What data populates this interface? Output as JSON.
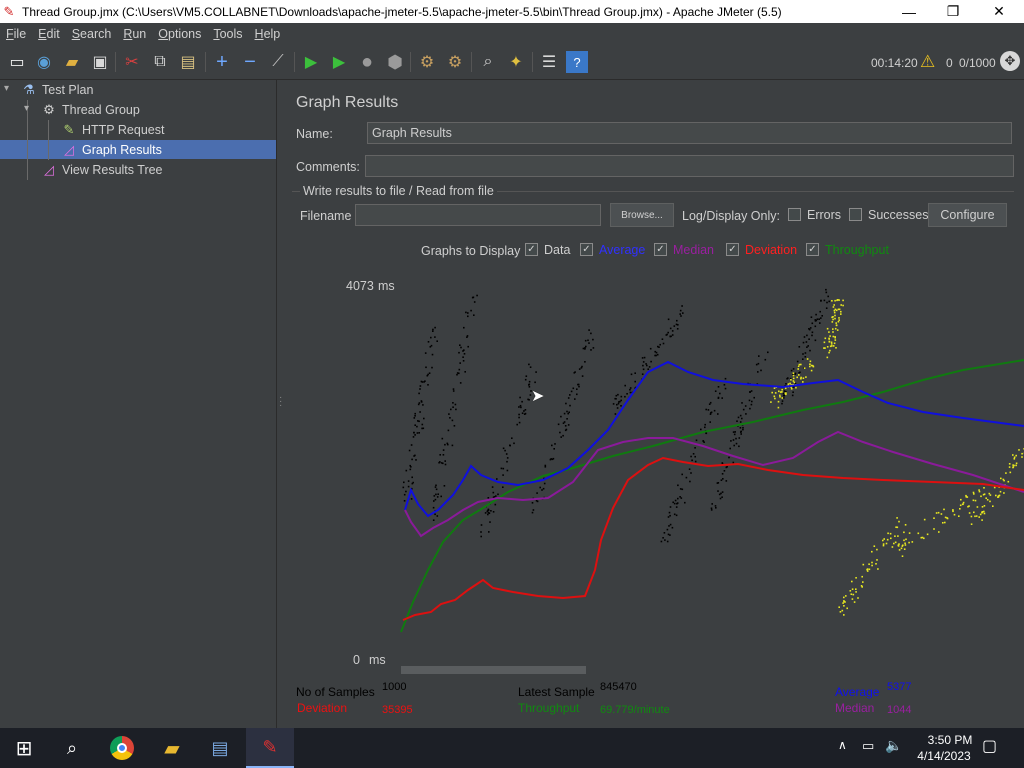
{
  "window": {
    "title": "Thread Group.jmx (C:\\Users\\VM5.COLLABNET\\Downloads\\apache-jmeter-5.5\\apache-jmeter-5.5\\bin\\Thread Group.jmx) - Apache JMeter (5.5)",
    "minimize": "—",
    "maximize": "❐",
    "close": "✕"
  },
  "menu": [
    "File",
    "Edit",
    "Search",
    "Run",
    "Options",
    "Tools",
    "Help"
  ],
  "toolbar": {
    "timer": "00:14:20",
    "warning_count": "0",
    "threads": "0/1000",
    "icons": [
      "new-icon",
      "templates-icon",
      "open-icon",
      "save-icon",
      "cut-icon",
      "copy-icon",
      "paste-icon",
      "expand-icon",
      "collapse-icon",
      "toggle-icon",
      "start-icon",
      "start-no-pause-icon",
      "stop-icon",
      "shutdown-icon",
      "clear-icon",
      "clear-all-icon",
      "search-icon",
      "reset-search-icon",
      "function-helper-icon",
      "help-icon"
    ]
  },
  "tree": {
    "test_plan": "Test Plan",
    "thread_group": "Thread Group",
    "http_request": "HTTP Request",
    "graph_results": "Graph Results",
    "view_results_tree": "View Results Tree"
  },
  "panel": {
    "title": "Graph Results",
    "name_label": "Name:",
    "name_value": "Graph Results",
    "comments_label": "Comments:",
    "comments_value": "",
    "write_results_label": "Write results to file / Read from file",
    "filename_label": "Filename",
    "filename_value": "",
    "browse_button": "Browse...",
    "log_display_label": "Log/Display Only:",
    "errors_label": "Errors",
    "successes_label": "Successes",
    "configure_button": "Configure",
    "graphs_to_display_label": "Graphs to Display",
    "graph_toggles": [
      {
        "label": "Data",
        "color": "#cfcfcf",
        "checked": true
      },
      {
        "label": "Average",
        "color": "#3030ff",
        "checked": true
      },
      {
        "label": "Median",
        "color": "#9a1fa0",
        "checked": true
      },
      {
        "label": "Deviation",
        "color": "#ff2020",
        "checked": true
      },
      {
        "label": "Throughput",
        "color": "#108a10",
        "checked": true
      }
    ]
  },
  "graph": {
    "y_max_label": "4073",
    "y_min_label": "0",
    "y_unit": "ms",
    "colors": {
      "data": "#000000",
      "average": "#1010dd",
      "median": "#8a1b9a",
      "deviation": "#dd1010",
      "throughput": "#107a10",
      "latest": "#e8e820"
    }
  },
  "stats": {
    "no_of_samples_label": "No of Samples",
    "no_of_samples_value": "1000",
    "latest_sample_label": "Latest Sample",
    "latest_sample_value": "845470",
    "average_label": "Average",
    "average_value": "5377",
    "deviation_label": "Deviation",
    "deviation_value": "35395",
    "throughput_label": "Throughput",
    "throughput_value": "69.779/minute",
    "median_label": "Median",
    "median_value": "1044"
  },
  "taskbar": {
    "time": "3:50 PM",
    "date": "4/14/2023",
    "icons": [
      "windows-start-icon",
      "search-icon",
      "chrome-icon",
      "file-explorer-icon",
      "server-manager-icon",
      "jmeter-icon"
    ]
  }
}
